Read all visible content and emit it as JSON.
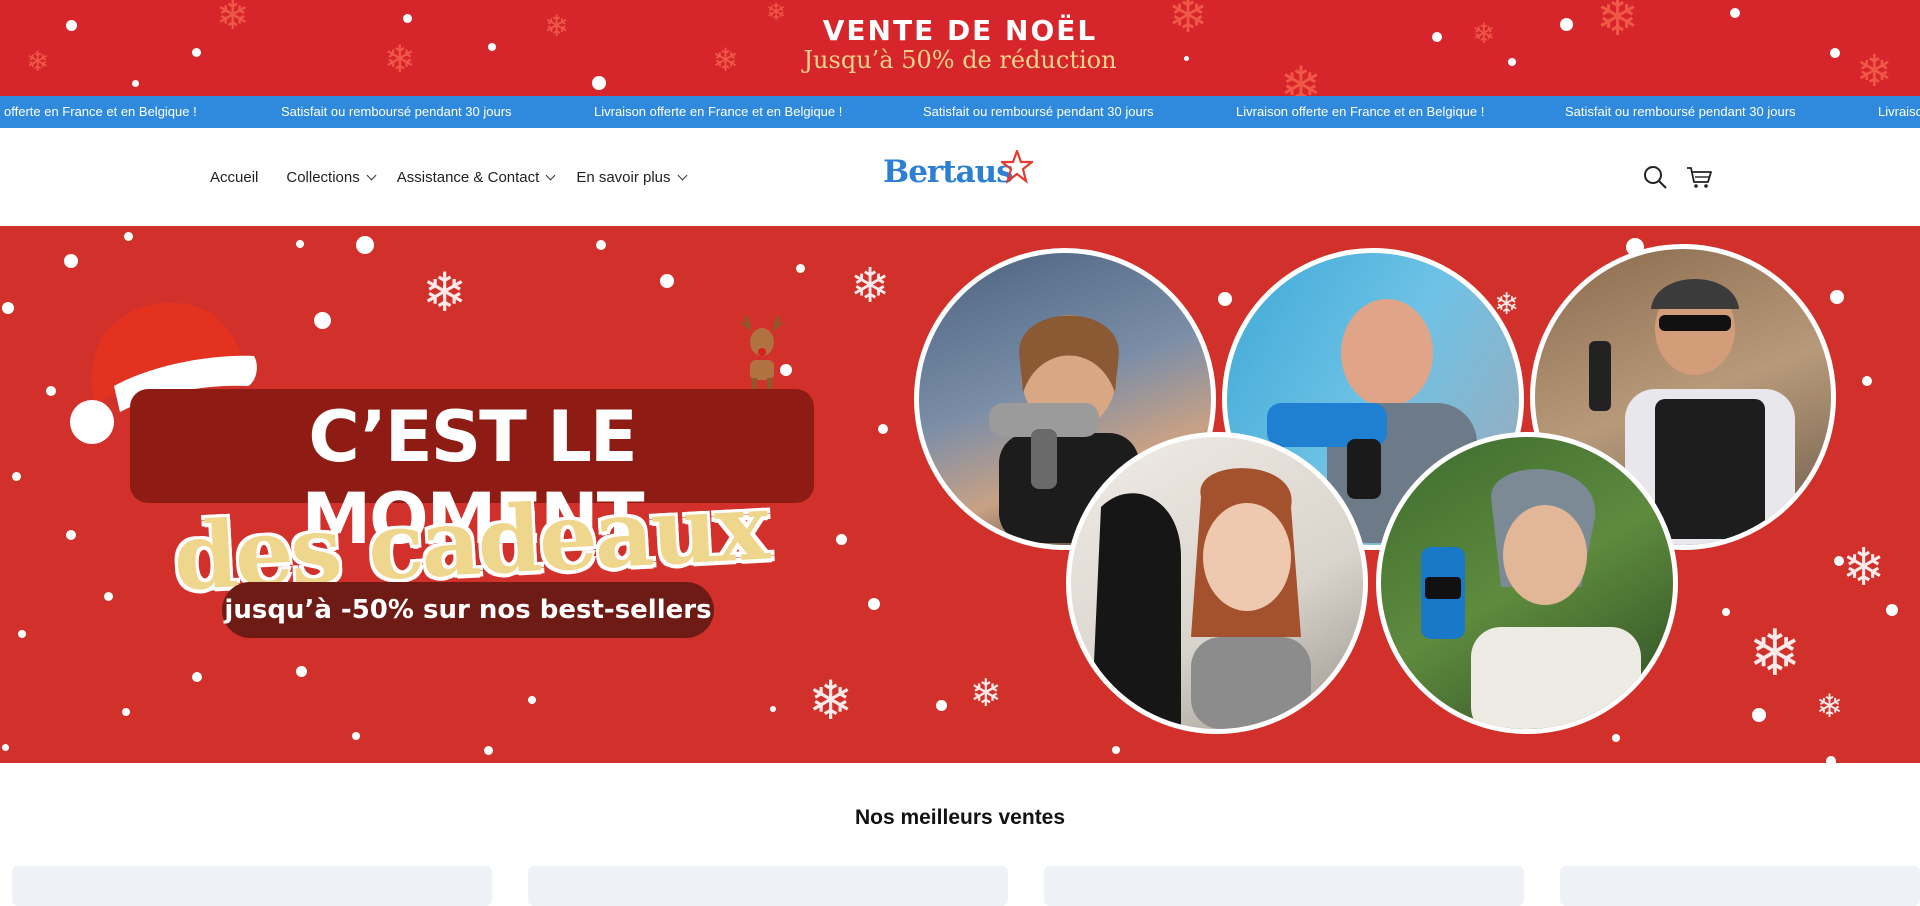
{
  "promo": {
    "title": "VENTE DE NOËL",
    "subtitle": "Jusqu’à 50% de réduction"
  },
  "marquee": {
    "messages": [
      "offerte en France et en Belgique !",
      "Satisfait ou remboursé pendant 30 jours",
      "Livraison offerte en France et en Belgique !",
      "Satisfait ou remboursé pendant 30 jours",
      "Livraison offerte en France et en Belgique !",
      "Satisfait ou remboursé pendant 30 jours",
      "Livraiso"
    ]
  },
  "nav": {
    "items": [
      {
        "label": "Accueil"
      },
      {
        "label": "Collections"
      },
      {
        "label": "Assistance & Contact"
      },
      {
        "label": "En savoir plus"
      }
    ]
  },
  "logo": {
    "text": "Bertaus"
  },
  "hero": {
    "headline": "C’EST LE MOMENT",
    "cursive": "des cadeaux",
    "subline": "jusqu’à -50% sur nos best-sellers"
  },
  "best_sellers": {
    "title": "Nos meilleurs ventes"
  },
  "colors": {
    "promo_red": "#d7262b",
    "marquee_blue": "#2f8ade",
    "hero_red": "#d2312b",
    "logo_blue": "#2c7fd3",
    "accent_gold": "#efd68d"
  },
  "icons": [
    "search-icon",
    "cart-icon",
    "chevron-down-icon",
    "star-icon",
    "santa-hat-icon",
    "reindeer-icon",
    "snowflake-icon"
  ]
}
